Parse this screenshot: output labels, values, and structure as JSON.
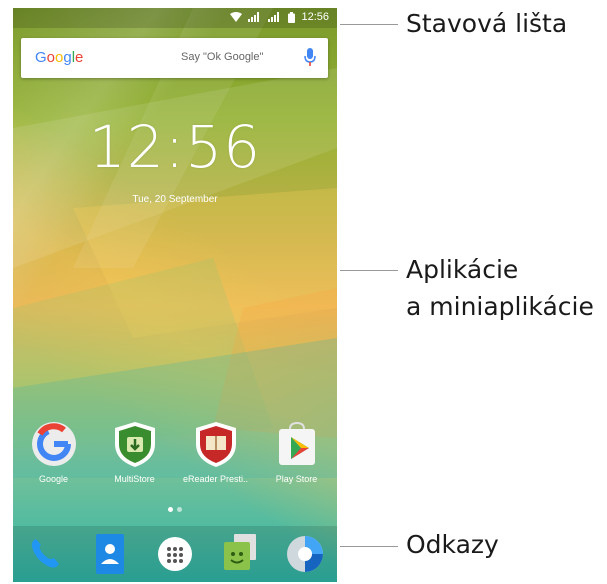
{
  "status_bar": {
    "time": "12:56"
  },
  "search": {
    "logo": "Google",
    "hint": "Say \"Ok Google\""
  },
  "clock": {
    "time": "12:56",
    "date": "Tue, 20 September"
  },
  "apps": [
    {
      "label": "Google",
      "icon": "google-icon"
    },
    {
      "label": "MultiStore",
      "icon": "multistore-icon"
    },
    {
      "label": "eReader Presti..",
      "icon": "ereader-icon"
    },
    {
      "label": "Play Store",
      "icon": "play-store-icon"
    }
  ],
  "dock": [
    {
      "icon": "phone-icon"
    },
    {
      "icon": "contacts-icon"
    },
    {
      "icon": "app-drawer-icon"
    },
    {
      "icon": "messaging-icon"
    },
    {
      "icon": "browser-icon"
    }
  ],
  "callouts": {
    "status_bar": "Stavová lišta",
    "apps_line1": "Aplikácie",
    "apps_line2": "a miniaplikácie",
    "shortcuts": "Odkazy"
  },
  "colors": {
    "google_blue": "#4285F4",
    "google_red": "#EA4335",
    "google_yellow": "#FBBC05",
    "google_green": "#34A853",
    "dock_phone": "#2196F3"
  }
}
